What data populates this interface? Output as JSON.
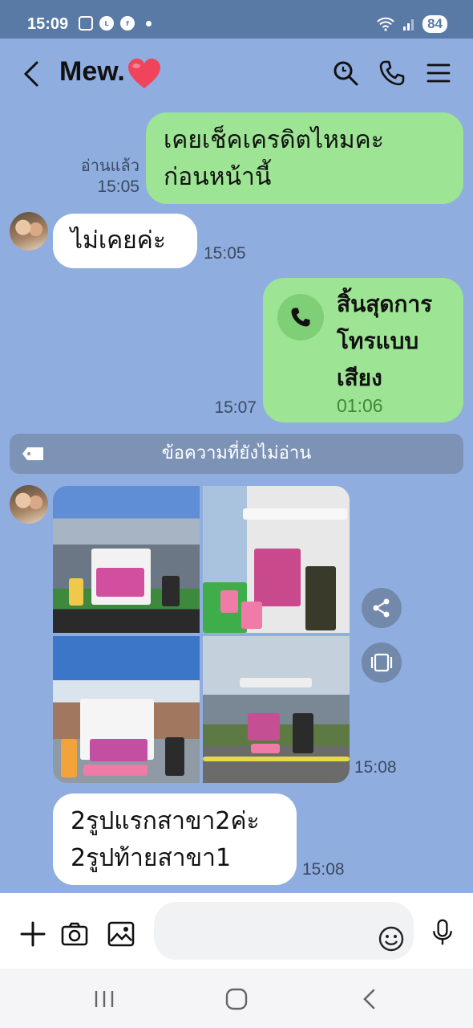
{
  "status": {
    "time": "15:09",
    "battery": "84"
  },
  "header": {
    "title": "Mew.",
    "icons": [
      "back-icon",
      "heart-icon",
      "search-icon",
      "phone-icon",
      "menu-icon"
    ]
  },
  "messages": [
    {
      "side": "right",
      "type": "text",
      "lines": [
        "เคยเช็คเครดิตไหมคะ",
        "ก่อนหน้านี้"
      ],
      "read": "อ่านแล้ว",
      "time": "15:05"
    },
    {
      "side": "left",
      "type": "text",
      "lines": [
        "ไม่เคยค่ะ"
      ],
      "time": "15:05"
    },
    {
      "side": "right",
      "type": "call",
      "lines": [
        "สิ้นสุดการ",
        "โทรแบบ",
        "เสียง"
      ],
      "duration": "01:06",
      "time": "15:07"
    },
    {
      "side": "left",
      "type": "photos",
      "count": 4,
      "time": "15:08"
    },
    {
      "side": "left",
      "type": "text",
      "lines": [
        "2รูปแรกสาขา2ค่ะ",
        "2รูปท้ายสาขา1"
      ],
      "time": "15:08"
    }
  ],
  "unread_divider": "ข้อความที่ยังไม่อ่าน",
  "colors": {
    "background": "#8faddf",
    "own_bubble": "#9de494",
    "other_bubble": "#ffffff",
    "status_bar": "#5a7aa6"
  }
}
